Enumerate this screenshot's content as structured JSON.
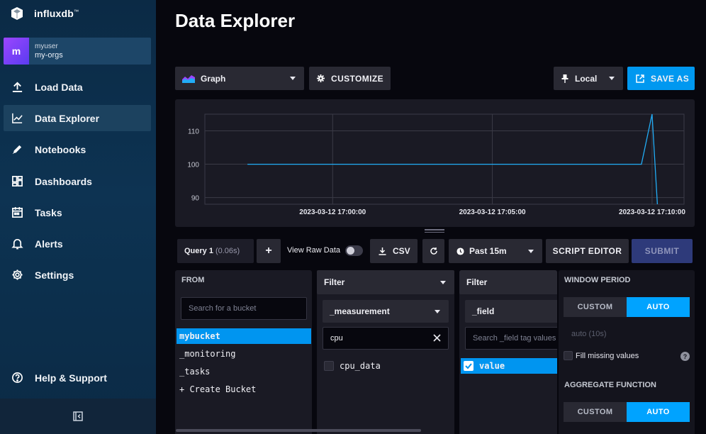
{
  "brand": {
    "name": "influxdb",
    "tm": "™"
  },
  "user": {
    "initial": "m",
    "name": "myuser",
    "org": "my-orgs"
  },
  "nav": [
    {
      "label": "Load Data",
      "icon": "upload-icon"
    },
    {
      "label": "Data Explorer",
      "icon": "graph-icon",
      "active": true
    },
    {
      "label": "Notebooks",
      "icon": "pencil-icon"
    },
    {
      "label": "Dashboards",
      "icon": "dashboard-icon"
    },
    {
      "label": "Tasks",
      "icon": "calendar-icon"
    },
    {
      "label": "Alerts",
      "icon": "bell-icon"
    },
    {
      "label": "Settings",
      "icon": "gear-icon"
    }
  ],
  "help": {
    "label": "Help & Support",
    "icon": "help-icon"
  },
  "page": {
    "title": "Data Explorer"
  },
  "toolbar": {
    "viz_type": "Graph",
    "customize": "CUSTOMIZE",
    "timezone": "Local",
    "save_as": "SAVE AS"
  },
  "chart_data": {
    "type": "line",
    "x": [
      "2023-03-12 16:57:20",
      "2023-03-12 17:09:40",
      "2023-03-12 17:10:00",
      "2023-03-12 17:10:10"
    ],
    "series": [
      {
        "values": [
          100,
          100,
          115,
          88
        ],
        "color": "#22adf6"
      }
    ],
    "x_ticks": [
      "2023-03-12 17:00:00",
      "2023-03-12 17:05:00",
      "2023-03-12 17:10:00"
    ],
    "y_ticks": [
      "90",
      "100",
      "110"
    ],
    "ylim": [
      88,
      115
    ],
    "grid": true
  },
  "query": {
    "tab_label": "Query 1",
    "tab_time": "(0.06s)",
    "add": "+",
    "raw_label": "View Raw Data",
    "csv": "CSV",
    "time_range": "Past 15m",
    "script_editor": "SCRIPT EDITOR",
    "submit": "SUBMIT"
  },
  "from_panel": {
    "header": "FROM",
    "search_placeholder": "Search for a bucket",
    "buckets": [
      "mybucket",
      "_monitoring",
      "_tasks",
      "+ Create Bucket"
    ]
  },
  "filter1": {
    "header": "Filter",
    "key": "_measurement",
    "search_value": "cpu",
    "items": [
      "cpu_data"
    ]
  },
  "filter2": {
    "header": "Filter",
    "key": "_field",
    "search_placeholder": "Search _field tag values",
    "items": [
      "value"
    ]
  },
  "window": {
    "header": "WINDOW PERIOD",
    "custom": "CUSTOM",
    "auto": "AUTO",
    "auto_hint": "auto (10s)",
    "fill_missing": "Fill missing values",
    "help_glyph": "?",
    "agg_header": "AGGREGATE FUNCTION",
    "agg_custom": "CUSTOM",
    "agg_auto": "AUTO"
  }
}
